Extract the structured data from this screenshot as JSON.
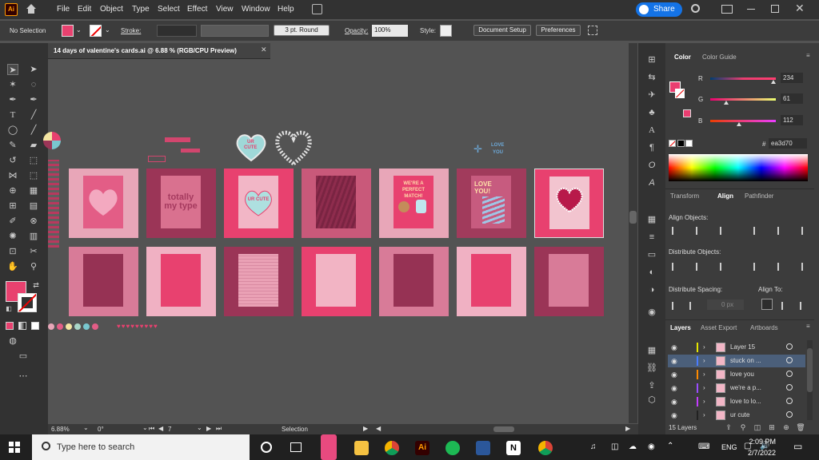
{
  "app": {
    "logo": "Ai",
    "share_label": "Share"
  },
  "menu": [
    "File",
    "Edit",
    "Object",
    "Type",
    "Select",
    "Effect",
    "View",
    "Window",
    "Help"
  ],
  "control_bar": {
    "selection": "No Selection",
    "stroke_label": "Stroke:",
    "brush_label": "3 pt. Round",
    "opacity_label": "Opacity:",
    "opacity_value": "100%",
    "style_label": "Style:",
    "document_setup": "Document Setup",
    "preferences": "Preferences",
    "fill_color": "#e8416f"
  },
  "document": {
    "tab_title": "14 days of valentine's cards.ai @ 6.88 % (RGB/CPU Preview)",
    "zoom": "6.88%",
    "rotation": "0°",
    "artboard_number": "7",
    "status_tool": "Selection"
  },
  "canvas": {
    "top_art": {
      "heart_text_1": "UR",
      "heart_text_2": "CUTE",
      "love_you_1": "LOVE",
      "love_you_2": "YOU"
    },
    "row1": [
      {
        "bg": "#e8a6b8",
        "paper": "#e35d86",
        "text": ""
      },
      {
        "bg": "#9b3557",
        "paper": "#d9718f",
        "text": "totally my type"
      },
      {
        "bg": "#e8416f",
        "paper": "#f2b6c6",
        "text": "UR CUTE"
      },
      {
        "bg": "#c9597a",
        "paper": "#8e2c4d",
        "text": ""
      },
      {
        "bg": "#e8a6b8",
        "paper": "#e8416f",
        "text": "WE'RE A PERFECT MATCH!"
      },
      {
        "bg": "#a13b5c",
        "paper": "#c75b7f",
        "text": "LOVE YOU!"
      },
      {
        "bg": "#e8416f",
        "paper": "#f2c4cf",
        "text": ""
      }
    ],
    "row2": [
      {
        "bg": "#d87b98",
        "paper": "#963254"
      },
      {
        "bg": "#f0b1c3",
        "paper": "#e8416f"
      },
      {
        "bg": "#9b3557",
        "paper": "#eaa1b5"
      },
      {
        "bg": "#e8416f",
        "paper": "#f2b4c4"
      },
      {
        "bg": "#d87b98",
        "paper": "#963254"
      },
      {
        "bg": "#f0b1c3",
        "paper": "#e8416f"
      },
      {
        "bg": "#9b3557",
        "paper": "#d87b98"
      }
    ],
    "swatches": [
      "#e8a6b8",
      "#e35d86",
      "#f5e6a3",
      "#a9d7c8",
      "#79c7cf",
      "#e35d86"
    ]
  },
  "color_panel": {
    "tabs": [
      "Color",
      "Color Guide"
    ],
    "r_label": "R",
    "g_label": "G",
    "b_label": "B",
    "r": 234,
    "g": 61,
    "b": 112,
    "r_val": "234",
    "g_val": "61",
    "b_val": "112",
    "hex_value": "ea3d70",
    "swatch_color": "#ea3d70"
  },
  "align_panel": {
    "tabs": [
      "Transform",
      "Align",
      "Pathfinder"
    ],
    "align_objects": "Align Objects:",
    "distribute_objects": "Distribute Objects:",
    "distribute_spacing": "Distribute Spacing:",
    "align_to": "Align To:",
    "spacing_value": "0 px"
  },
  "layers_panel": {
    "tabs": [
      "Layers",
      "Asset Export",
      "Artboards"
    ],
    "layers": [
      {
        "name": "Layer 15",
        "color": "#e6e600",
        "selected": false
      },
      {
        "name": "stuck on ...",
        "color": "#4a7cff",
        "selected": true
      },
      {
        "name": "love you",
        "color": "#ff8a00",
        "selected": false
      },
      {
        "name": "we're a p...",
        "color": "#9a4dff",
        "selected": false
      },
      {
        "name": "love to lo...",
        "color": "#c43cff",
        "selected": false
      },
      {
        "name": "ur cute",
        "color": "#222222",
        "selected": false
      }
    ],
    "count": "15 Layers"
  },
  "taskbar": {
    "search_placeholder": "Type here to search",
    "language": "ENG",
    "time": "2:09 PM",
    "date": "2/7/2022"
  }
}
